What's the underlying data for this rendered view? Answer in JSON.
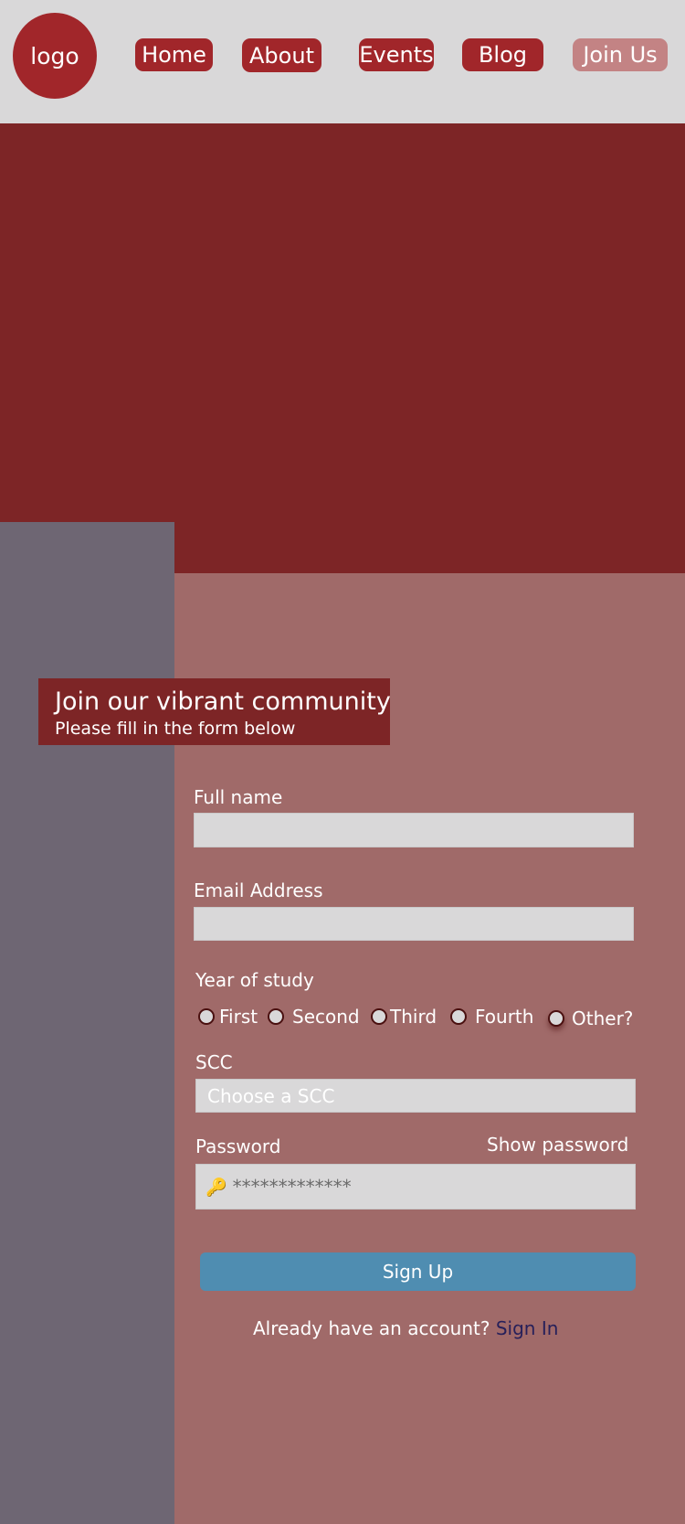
{
  "header": {
    "logo_text": "logo",
    "nav": [
      {
        "label": "Home"
      },
      {
        "label": "About"
      },
      {
        "label": "Events"
      },
      {
        "label": "Blog"
      },
      {
        "label": "Join Us",
        "active": true
      }
    ]
  },
  "form": {
    "heading": "Join our vibrant community",
    "subheading": "Please fill in the form below",
    "full_name_label": "Full name",
    "full_name_value": "",
    "email_label": "Email Address",
    "email_value": "",
    "year_label": "Year of study",
    "year_options": [
      "First",
      "Second",
      "Third",
      "Fourth",
      "Other?"
    ],
    "scc_label": "SCC",
    "scc_placeholder": "Choose a SCC",
    "password_label": "Password",
    "show_password": "Show password",
    "password_icon": "key-icon",
    "password_value": "*************",
    "submit": "Sign Up",
    "signin_prompt": "Already have an account?",
    "signin_link": "Sign In"
  },
  "colors": {
    "primary": "#a1262a",
    "hero": "#7d2526",
    "form_bg": "#a06a69",
    "side": "#6e6673",
    "button": "#4f8db1",
    "link": "#27205a"
  }
}
